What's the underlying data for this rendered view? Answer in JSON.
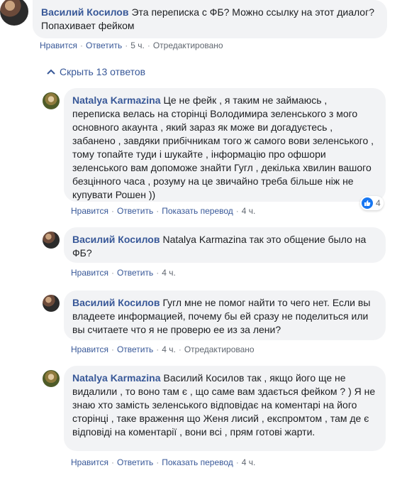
{
  "top_comment": {
    "author": "Василий Косилов",
    "text": "Эта переписка с ФБ? Можно ссылку на этот диалог? Попахивает фейком",
    "actions": {
      "like": "Нравится",
      "reply": "Ответить",
      "time": "5 ч.",
      "edited": "Отредактировано"
    }
  },
  "hide_replies": "Скрыть 13 ответов",
  "replies": [
    {
      "author": "Natalya Karmazina",
      "text": "Це не фейк , я таким не займаюсь , переписка велась на сторінці Володимира зеленського з мого основного акаунта , який зараз як може ви догадуєтесь , забанено , завдяки прибічникам того ж самого вови зеленського , тому топайте туди і шукайте , інформацію про офшори зеленського вам допоможе знайти Гугл , декілька хвилин вашого безцінного часа , розуму на це звичайно треба більше ніж не купувати Рошен ))",
      "reaction_count": "4",
      "actions": {
        "like": "Нравится",
        "reply": "Ответить",
        "translate": "Показать перевод",
        "time": "4 ч."
      }
    },
    {
      "author": "Василий Косилов",
      "text": "Natalya Karmazina так это общение было на ФБ?",
      "actions": {
        "like": "Нравится",
        "reply": "Ответить",
        "time": "4 ч."
      }
    },
    {
      "author": "Василий Косилов",
      "text": "Гугл мне не помог найти то чего нет. Если вы владеете информацией, почему бы ей сразу не поделиться или вы считаете что я не проверю ее из за лени?",
      "actions": {
        "like": "Нравится",
        "reply": "Ответить",
        "time": "4 ч.",
        "edited": "Отредактировано"
      }
    },
    {
      "author": "Natalya Karmazina",
      "text": "Василий Косилов так , якщо його ще не видалили , то воно там є , що саме вам здається фейком ? ) Я не знаю хто замість зеленського відповідає на коментарі на його сторінці , таке враження що Женя лисий , експромтом , там де є відповіді на коментарії , вони всі , прям готові жарти.",
      "actions": {
        "like": "Нравится",
        "reply": "Ответить",
        "translate": "Показать перевод",
        "time": "4 ч."
      }
    }
  ],
  "colors": {
    "link": "#385898",
    "bubble": "#f2f3f5",
    "meta": "#606770",
    "like_blue": "#1877f2"
  }
}
